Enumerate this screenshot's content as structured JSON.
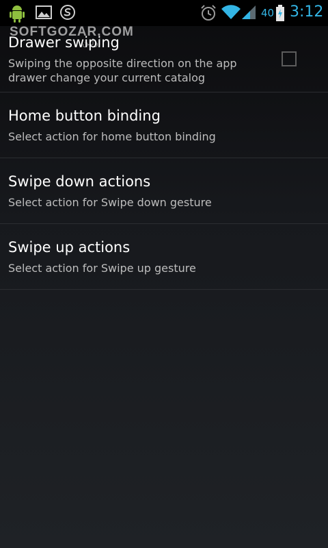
{
  "status_bar": {
    "battery_level": "40",
    "time": "3:12",
    "accent_color": "#33b5e5",
    "icons": [
      "android-robot-icon",
      "image-icon",
      "s-logo-icon",
      "alarm-icon",
      "wifi-icon",
      "signal-icon",
      "battery-charging-icon"
    ]
  },
  "watermark": {
    "text": "SOFTGOZAR.COM",
    "subtext": "اولین"
  },
  "settings": {
    "items": [
      {
        "title": "Drawer swiping",
        "summary": "Swiping the opposite direction on the app drawer change your current catalog",
        "checked": false
      },
      {
        "title": "Home button binding",
        "summary": "Select action for home button binding"
      },
      {
        "title": "Swipe down actions",
        "summary": "Select action for Swipe down gesture"
      },
      {
        "title": "Swipe up actions",
        "summary": "Select action for Swipe up gesture"
      }
    ]
  }
}
